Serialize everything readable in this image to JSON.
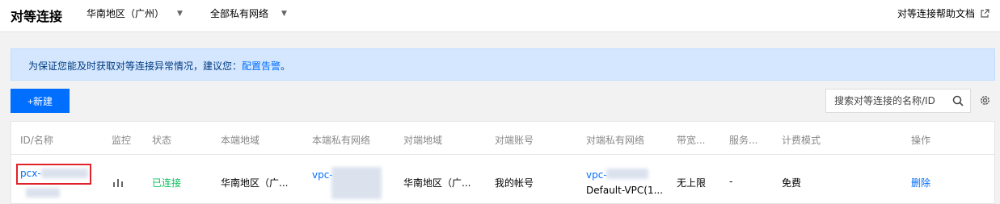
{
  "header": {
    "title": "对等连接",
    "region_select": "华南地区（广州）",
    "vpc_select": "全部私有网络",
    "help_link": "对等连接帮助文档"
  },
  "notice": {
    "text": "为保证您能及时获取对等连接异常情况，建议您：",
    "link": "配置告警",
    "suffix": "。"
  },
  "toolbar": {
    "new_button": "+新建",
    "search_placeholder": "搜索对等连接的名称/ID"
  },
  "table": {
    "columns": [
      "ID/名称",
      "监控",
      "状态",
      "本端地域",
      "本端私有网络",
      "对端地域",
      "对端账号",
      "对端私有网络",
      "带宽...",
      "服务...",
      "计费模式",
      "操作"
    ],
    "rows": [
      {
        "id": "pcx-",
        "status": "已连接",
        "local_region": "华南地区（广...",
        "local_vpc": "vpc-",
        "peer_region": "华南地区（广...",
        "peer_account": "我的帐号",
        "peer_vpc": "vpc-",
        "peer_vpc_name": "Default-VPC(1...",
        "bandwidth": "无上限",
        "service": "-",
        "billing": "免费",
        "action": "删除"
      }
    ]
  },
  "colors": {
    "accent": "#006eff",
    "connected": "#0abf5b",
    "notice_bg": "#d5e7ff",
    "highlight_border": "#e0232a"
  },
  "icons": [
    "chevron-down-icon",
    "external-link-icon",
    "search-icon",
    "gear-icon",
    "monitor-chart-icon"
  ]
}
